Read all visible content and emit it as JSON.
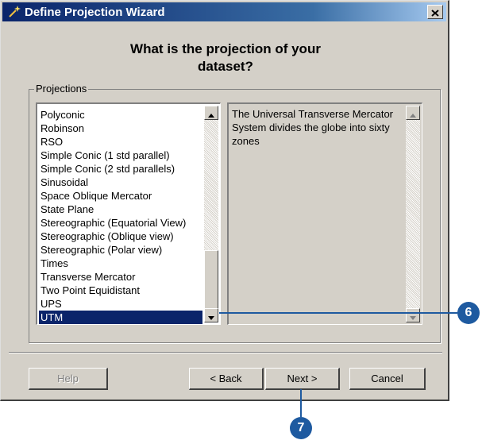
{
  "window": {
    "title": "Define Projection Wizard",
    "wand_icon": "magic-wand-icon",
    "close_icon": "close-icon"
  },
  "question": "What is the projection of your\ndataset?",
  "projections_group": {
    "label": "Projections",
    "items": [
      "Polyconic",
      "Robinson",
      "RSO",
      "Simple Conic (1 std parallel)",
      "Simple Conic (2 std parallels)",
      "Sinusoidal",
      "Space Oblique Mercator",
      "State Plane",
      "Stereographic (Equatorial View)",
      "Stereographic (Oblique view)",
      "Stereographic (Polar view)",
      "Times",
      "Transverse Mercator",
      "Two Point Equidistant",
      "UPS",
      "UTM"
    ],
    "selected": "UTM",
    "description": "The Universal Transverse Mercator System divides the globe into sixty zones"
  },
  "buttons": {
    "help": "Help",
    "back": "< Back",
    "next": "Next >",
    "cancel": "Cancel"
  },
  "callouts": {
    "step_6": "6",
    "step_7": "7"
  },
  "colors": {
    "titlebar_start": "#0a246a",
    "selection": "#0a246a",
    "callout": "#1e5aa0"
  }
}
